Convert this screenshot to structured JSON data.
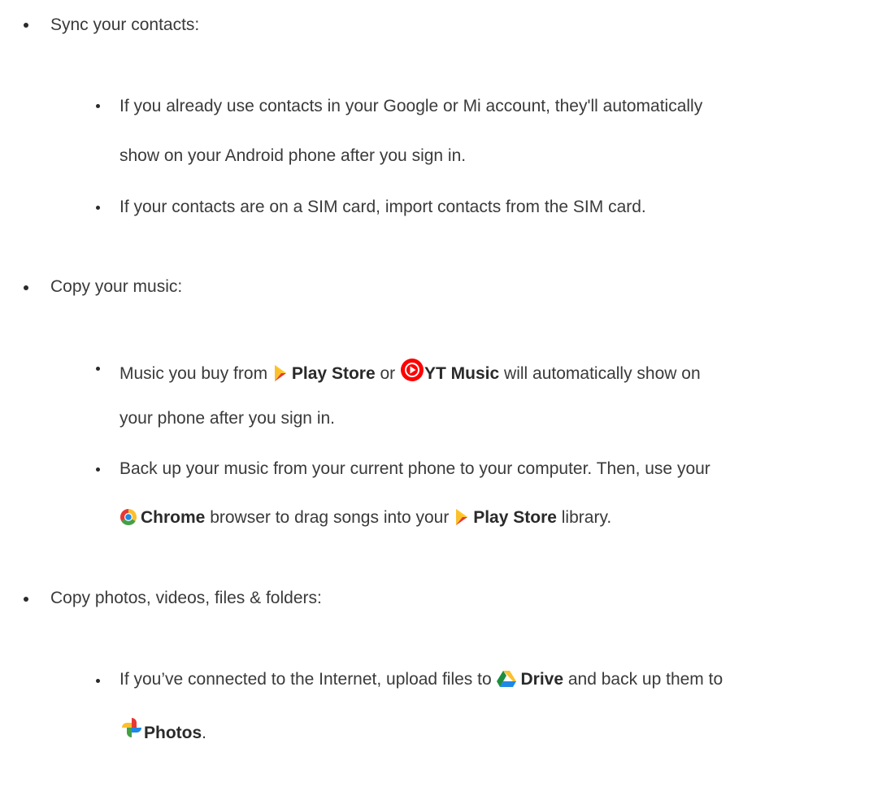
{
  "sections": [
    {
      "heading": "Sync your contacts:",
      "items": [
        {
          "line1": "If you already use contacts in your Google or Mi account, they'll automatically",
          "line2": "show on your Android phone after you sign in."
        },
        {
          "line1": "If your contacts are on a SIM card, import contacts from the SIM card."
        }
      ]
    },
    {
      "heading": "Copy your music:",
      "items": [
        {
          "line1_pre": "Music you buy from",
          "line1_app1": "Play Store",
          "line1_mid": "or",
          "line1_app2": "YT Music",
          "line1_post": "will automatically show on",
          "line2": "your phone after you sign in."
        },
        {
          "line1": "Back up your music from your current phone to your computer. Then, use your",
          "line2_app1": "Chrome",
          "line2_mid": "browser to drag songs into your",
          "line2_app2": "Play Store",
          "line2_post": "library."
        }
      ]
    },
    {
      "heading": "Copy photos, videos, files & folders:",
      "items": [
        {
          "line1_pre": "If you’ve connected to the Internet, upload files to",
          "line1_app": "Drive",
          "line1_post": "and back up them to",
          "line2_app": "Photos",
          "line2_post": "."
        }
      ]
    }
  ],
  "icons": {
    "play_store": "play-store-icon",
    "yt_music": "yt-music-icon",
    "chrome": "chrome-icon",
    "drive": "drive-icon",
    "photos": "photos-icon"
  },
  "colors": {
    "text": "#3a3a3a",
    "bold_text": "#2a2a2a",
    "yt_red": "#ff0000",
    "play_orange": "#f9a825",
    "play_red": "#e53935"
  }
}
